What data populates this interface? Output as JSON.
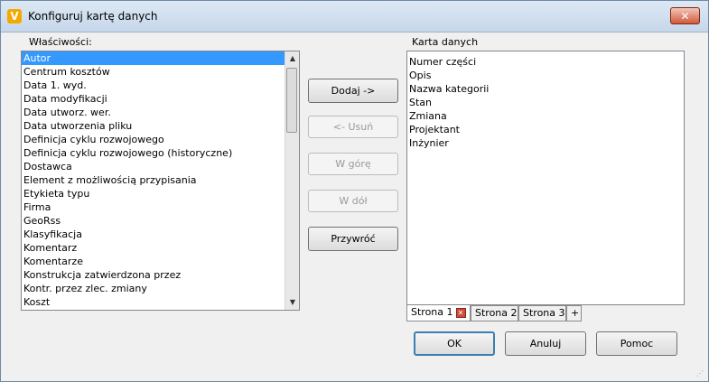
{
  "window": {
    "title": "Konfiguruj kartę danych",
    "close_glyph": "✕",
    "app_icon_glyph": "V"
  },
  "left": {
    "label": "Właściwości:",
    "items": [
      "Autor",
      "Centrum kosztów",
      "Data 1. wyd.",
      "Data modyfikacji",
      "Data utworz. wer.",
      "Data utworzenia pliku",
      "Definicja cyklu rozwojowego",
      "Definicja cyklu rozwojowego (historyczne)",
      "Dostawca",
      "Element z możliwością przypisania",
      "Etykieta typu",
      "Firma",
      "GeoRss",
      "Klasyfikacja",
      "Komentarz",
      "Komentarze",
      "Konstrukcja zatwierdzona przez",
      "Kontr. przez zlec. zmiany",
      "Koszt"
    ],
    "selected_index": 0
  },
  "middle": {
    "add": "Dodaj ->",
    "remove": "<- Usuń",
    "up": "W górę",
    "down": "W dół",
    "restore": "Przywróć"
  },
  "right": {
    "label": "Karta danych",
    "items": [
      "Numer części",
      "Opis",
      "Nazwa kategorii",
      "Stan",
      "Zmiana",
      "Projektant",
      "Inżynier"
    ]
  },
  "tabs": [
    {
      "label": "Strona 1"
    },
    {
      "label": "Strona 2"
    },
    {
      "label": "Strona 3"
    },
    {
      "label": "+"
    }
  ],
  "footer": {
    "ok": "OK",
    "cancel": "Anuluj",
    "help": "Pomoc"
  },
  "icons": {
    "tab_close": "close-icon",
    "scroll_up": "▲",
    "scroll_down": "▼",
    "grip": "⋰"
  }
}
